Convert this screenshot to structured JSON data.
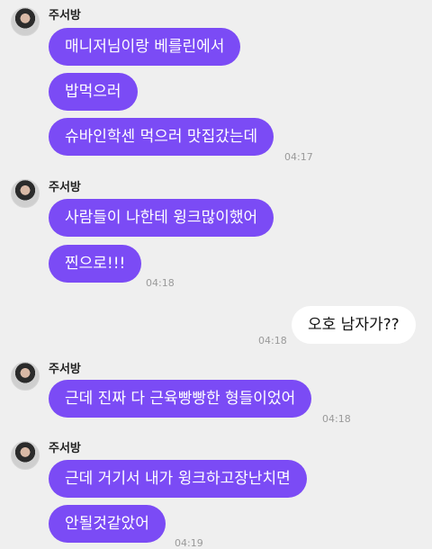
{
  "sender_name": "주서방",
  "messages": [
    {
      "text": "매니저님이랑 베를린에서"
    },
    {
      "text": "밥먹으러"
    },
    {
      "text": "슈바인학센 먹으러 맛집갔는데",
      "time": "04:17"
    },
    {
      "text": "사람들이 나한테 윙크많이했어"
    },
    {
      "text": "찐으로!!!",
      "time": "04:18"
    },
    {
      "text": "오호 남자가??",
      "time": "04:18"
    },
    {
      "text": "근데 진짜 다 근육빵빵한 형들이었어",
      "time": "04:18"
    },
    {
      "text": "근데 거기서 내가 윙크하고장난치면"
    },
    {
      "text": "안될것같았어",
      "time": "04:19"
    }
  ]
}
